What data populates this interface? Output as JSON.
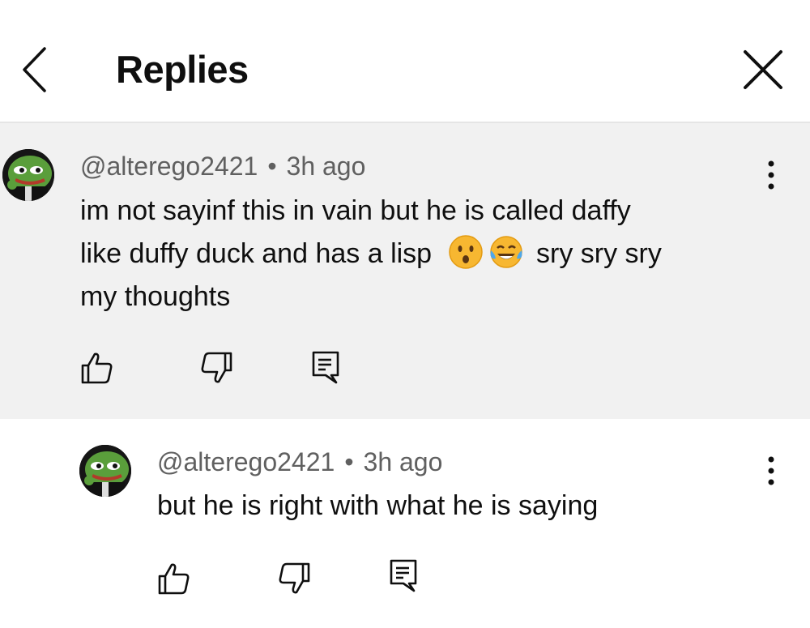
{
  "header": {
    "title": "Replies"
  },
  "comment": {
    "author": "@alterego2421",
    "separator": "•",
    "time": "3h ago",
    "text_line1": "im not sayinf this in vain but he is called daffy",
    "text_line2_a": "like duffy duck and has a lisp",
    "text_line2_b": "sry sry sry",
    "text_line3": "my thoughts",
    "emojis": [
      "hushed-face-emoji",
      "tears-of-joy-emoji"
    ]
  },
  "reply": {
    "author": "@alterego2421",
    "separator": "•",
    "time": "3h ago",
    "text": "but he is right with what he is saying"
  },
  "icons": [
    "chevron-left-icon",
    "close-icon",
    "more-vertical-icon",
    "thumbs-up-icon",
    "thumbs-down-icon",
    "reply-icon"
  ],
  "colors": {
    "meta_text": "#606060",
    "highlight_background": "#f1f1f1",
    "divider": "#e5e5e5"
  }
}
